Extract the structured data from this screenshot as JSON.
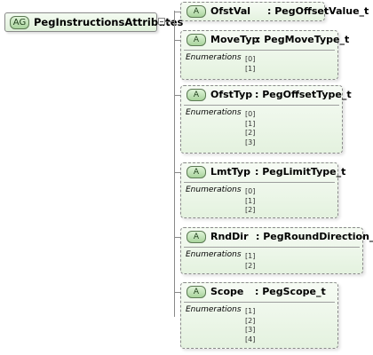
{
  "attribute_group": {
    "badge": "AG",
    "name": "PegInstructionsAttributes"
  },
  "attributes": [
    {
      "badge": "A",
      "name": "OfstVal",
      "type": ": PegOffsetValue_t",
      "enumerations_label": "",
      "enumerations": []
    },
    {
      "badge": "A",
      "name": "MoveTyp",
      "type": ": PegMoveType_t",
      "enumerations_label": "Enumerations",
      "enumerations": [
        "[0]",
        "[1]"
      ]
    },
    {
      "badge": "A",
      "name": "OfstTyp",
      "type": ": PegOffsetType_t",
      "enumerations_label": "Enumerations",
      "enumerations": [
        "[0]",
        "[1]",
        "[2]",
        "[3]"
      ]
    },
    {
      "badge": "A",
      "name": "LmtTyp",
      "type": ": PegLimitType_t",
      "enumerations_label": "Enumerations",
      "enumerations": [
        "[0]",
        "[1]",
        "[2]"
      ]
    },
    {
      "badge": "A",
      "name": "RndDir",
      "type": ": PegRoundDirection_t",
      "enumerations_label": "Enumerations",
      "enumerations": [
        "[1]",
        "[2]"
      ]
    },
    {
      "badge": "A",
      "name": "Scope",
      "type": ": PegScope_t",
      "enumerations_label": "Enumerations",
      "enumerations": [
        "[1]",
        "[2]",
        "[3]",
        "[4]"
      ]
    }
  ]
}
